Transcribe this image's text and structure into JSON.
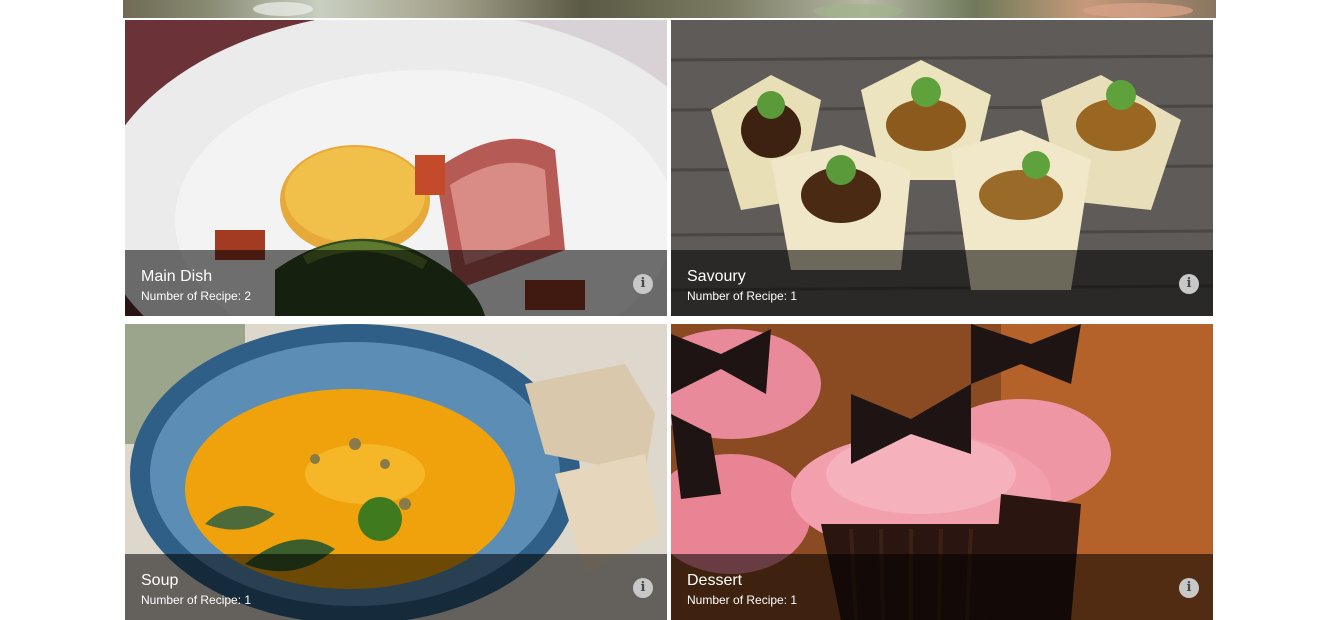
{
  "categories": [
    {
      "title": "Main Dish",
      "count_text": "Number of Recipe: 2"
    },
    {
      "title": "Savoury",
      "count_text": "Number of Recipe: 1"
    },
    {
      "title": "Soup",
      "count_text": "Number of Recipe: 1"
    },
    {
      "title": "Dessert",
      "count_text": "Number of Recipe: 1"
    }
  ],
  "info_icon": "info-icon",
  "colors": {
    "overlay": "#000000",
    "text": "#ffffff"
  }
}
